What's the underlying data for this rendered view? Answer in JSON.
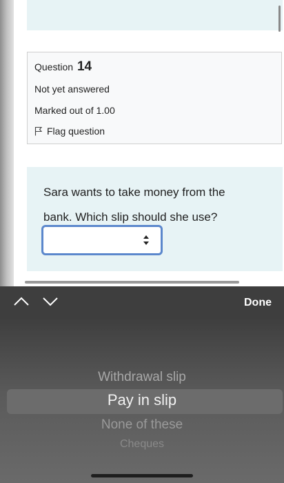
{
  "question": {
    "label": "Question",
    "number": "14",
    "status": "Not yet answered",
    "marks": "Marked out of 1.00",
    "flag_label": "Flag question",
    "text": "Sara wants to take money from the bank. Which slip should she use?"
  },
  "select": {
    "value": ""
  },
  "toolbar": {
    "done_label": "Done"
  },
  "picker": {
    "options": [
      "Withdrawal slip",
      "Pay in slip",
      "None of these",
      "Cheques"
    ],
    "selected": "Pay in slip"
  },
  "icons": {
    "prev": "chevron-up-icon",
    "next": "chevron-down-icon",
    "flag": "flag-icon",
    "select_arrows": "updown-arrows-icon"
  }
}
